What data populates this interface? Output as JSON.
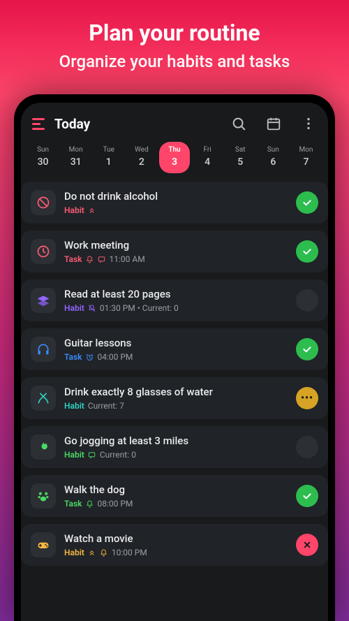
{
  "promo": {
    "title": "Plan your routine",
    "subtitle": "Organize your habits and tasks"
  },
  "appbar": {
    "title": "Today"
  },
  "days": [
    {
      "dow": "Sun",
      "num": "30",
      "selected": false
    },
    {
      "dow": "Mon",
      "num": "31",
      "selected": false
    },
    {
      "dow": "Tue",
      "num": "1",
      "selected": false
    },
    {
      "dow": "Wed",
      "num": "2",
      "selected": false
    },
    {
      "dow": "Thu",
      "num": "3",
      "selected": true
    },
    {
      "dow": "Fri",
      "num": "4",
      "selected": false
    },
    {
      "dow": "Sat",
      "num": "5",
      "selected": false
    },
    {
      "dow": "Sun",
      "num": "6",
      "selected": false
    },
    {
      "dow": "Mon",
      "num": "7",
      "selected": false
    }
  ],
  "items": [
    {
      "icon": "ban-icon",
      "iconColor": "c-red",
      "name": "Do not drink alcohol",
      "kind": "Habit",
      "kindColor": "c-red",
      "metaIcons": [
        "priority"
      ],
      "detail": "",
      "status": "done"
    },
    {
      "icon": "clock-icon",
      "iconColor": "c-red",
      "name": "Work meeting",
      "kind": "Task",
      "kindColor": "c-red",
      "metaIcons": [
        "bell",
        "comment"
      ],
      "detail": "11:00 AM",
      "status": "done"
    },
    {
      "icon": "book-icon",
      "iconColor": "c-purple",
      "name": "Read at least 20 pages",
      "kind": "Habit",
      "kindColor": "c-purple",
      "metaIcons": [
        "bell-mute"
      ],
      "detail": "01:30 PM • Current: 0",
      "status": "none"
    },
    {
      "icon": "headphones-icon",
      "iconColor": "c-blue",
      "name": "Guitar lessons",
      "kind": "Task",
      "kindColor": "c-blue",
      "metaIcons": [
        "alarm"
      ],
      "detail": "04:00 PM",
      "status": "done"
    },
    {
      "icon": "utensils-icon",
      "iconColor": "c-teal",
      "name": "Drink exactly 8 glasses of water",
      "kind": "Habit",
      "kindColor": "c-teal",
      "metaIcons": [],
      "detail": "Current: 7",
      "status": "pending"
    },
    {
      "icon": "flame-icon",
      "iconColor": "c-green",
      "name": "Go jogging at least 3 miles",
      "kind": "Habit",
      "kindColor": "c-green",
      "metaIcons": [
        "comment"
      ],
      "detail": "Current: 0",
      "status": "none"
    },
    {
      "icon": "paw-icon",
      "iconColor": "c-green",
      "name": "Walk the dog",
      "kind": "Task",
      "kindColor": "c-green",
      "metaIcons": [
        "bell"
      ],
      "detail": "08:00 PM",
      "status": "done"
    },
    {
      "icon": "gamepad-icon",
      "iconColor": "c-yellow",
      "name": "Watch a movie",
      "kind": "Habit",
      "kindColor": "c-yellow",
      "metaIcons": [
        "priority",
        "bell"
      ],
      "detail": "10:00 PM",
      "status": "fail"
    }
  ]
}
